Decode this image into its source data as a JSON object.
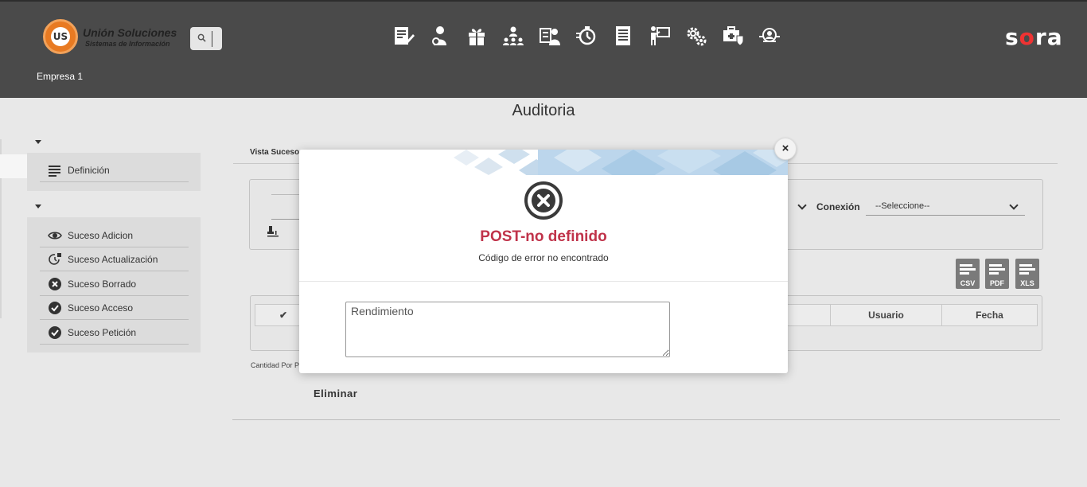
{
  "header": {
    "logo_title": "Unión Soluciones",
    "logo_subtitle": "Sistemas de Información",
    "logo_mark": "US",
    "brand_prefix": "s",
    "brand_dot": "o",
    "brand_suffix": "ra",
    "company": "Empresa 1",
    "nav_icons": [
      "document-edit-icon",
      "person-settings-icon",
      "gift-icon",
      "organization-icon",
      "id-card-person-icon",
      "stopwatch-icon",
      "report-list-icon",
      "presentation-icon",
      "gears-icon",
      "medical-kit-shield-icon",
      "user-search-icon"
    ]
  },
  "page": {
    "title": "Auditoria"
  },
  "sidebar": {
    "group1": {
      "items": [
        {
          "label": "Definición",
          "icon": "list-icon"
        }
      ]
    },
    "group2": {
      "items": [
        {
          "label": "Suceso Adicion",
          "icon": "eye-icon"
        },
        {
          "label": "Suceso Actualización",
          "icon": "clock-refresh-icon"
        },
        {
          "label": "Suceso Borrado",
          "icon": "x-circle-icon"
        },
        {
          "label": "Suceso Acceso",
          "icon": "check-circle-icon"
        },
        {
          "label": "Suceso Petición",
          "icon": "check-circle-icon"
        }
      ]
    }
  },
  "content": {
    "vista_label": "Vista Suceso",
    "conexion_label": "Conexión",
    "conexion_value": "--Seleccione--",
    "exports": [
      "CSV",
      "PDF",
      "XLS"
    ],
    "table_headers": {
      "check": "✔",
      "usuario": "Usuario",
      "fecha": "Fecha"
    },
    "cantidad_label": "Cantidad Por P",
    "eliminar_label": "Eliminar"
  },
  "modal": {
    "title": "POST-no definido",
    "subtitle": "Código de error no encontrado",
    "textarea_value": "Rendimiento",
    "close_label": "×"
  }
}
